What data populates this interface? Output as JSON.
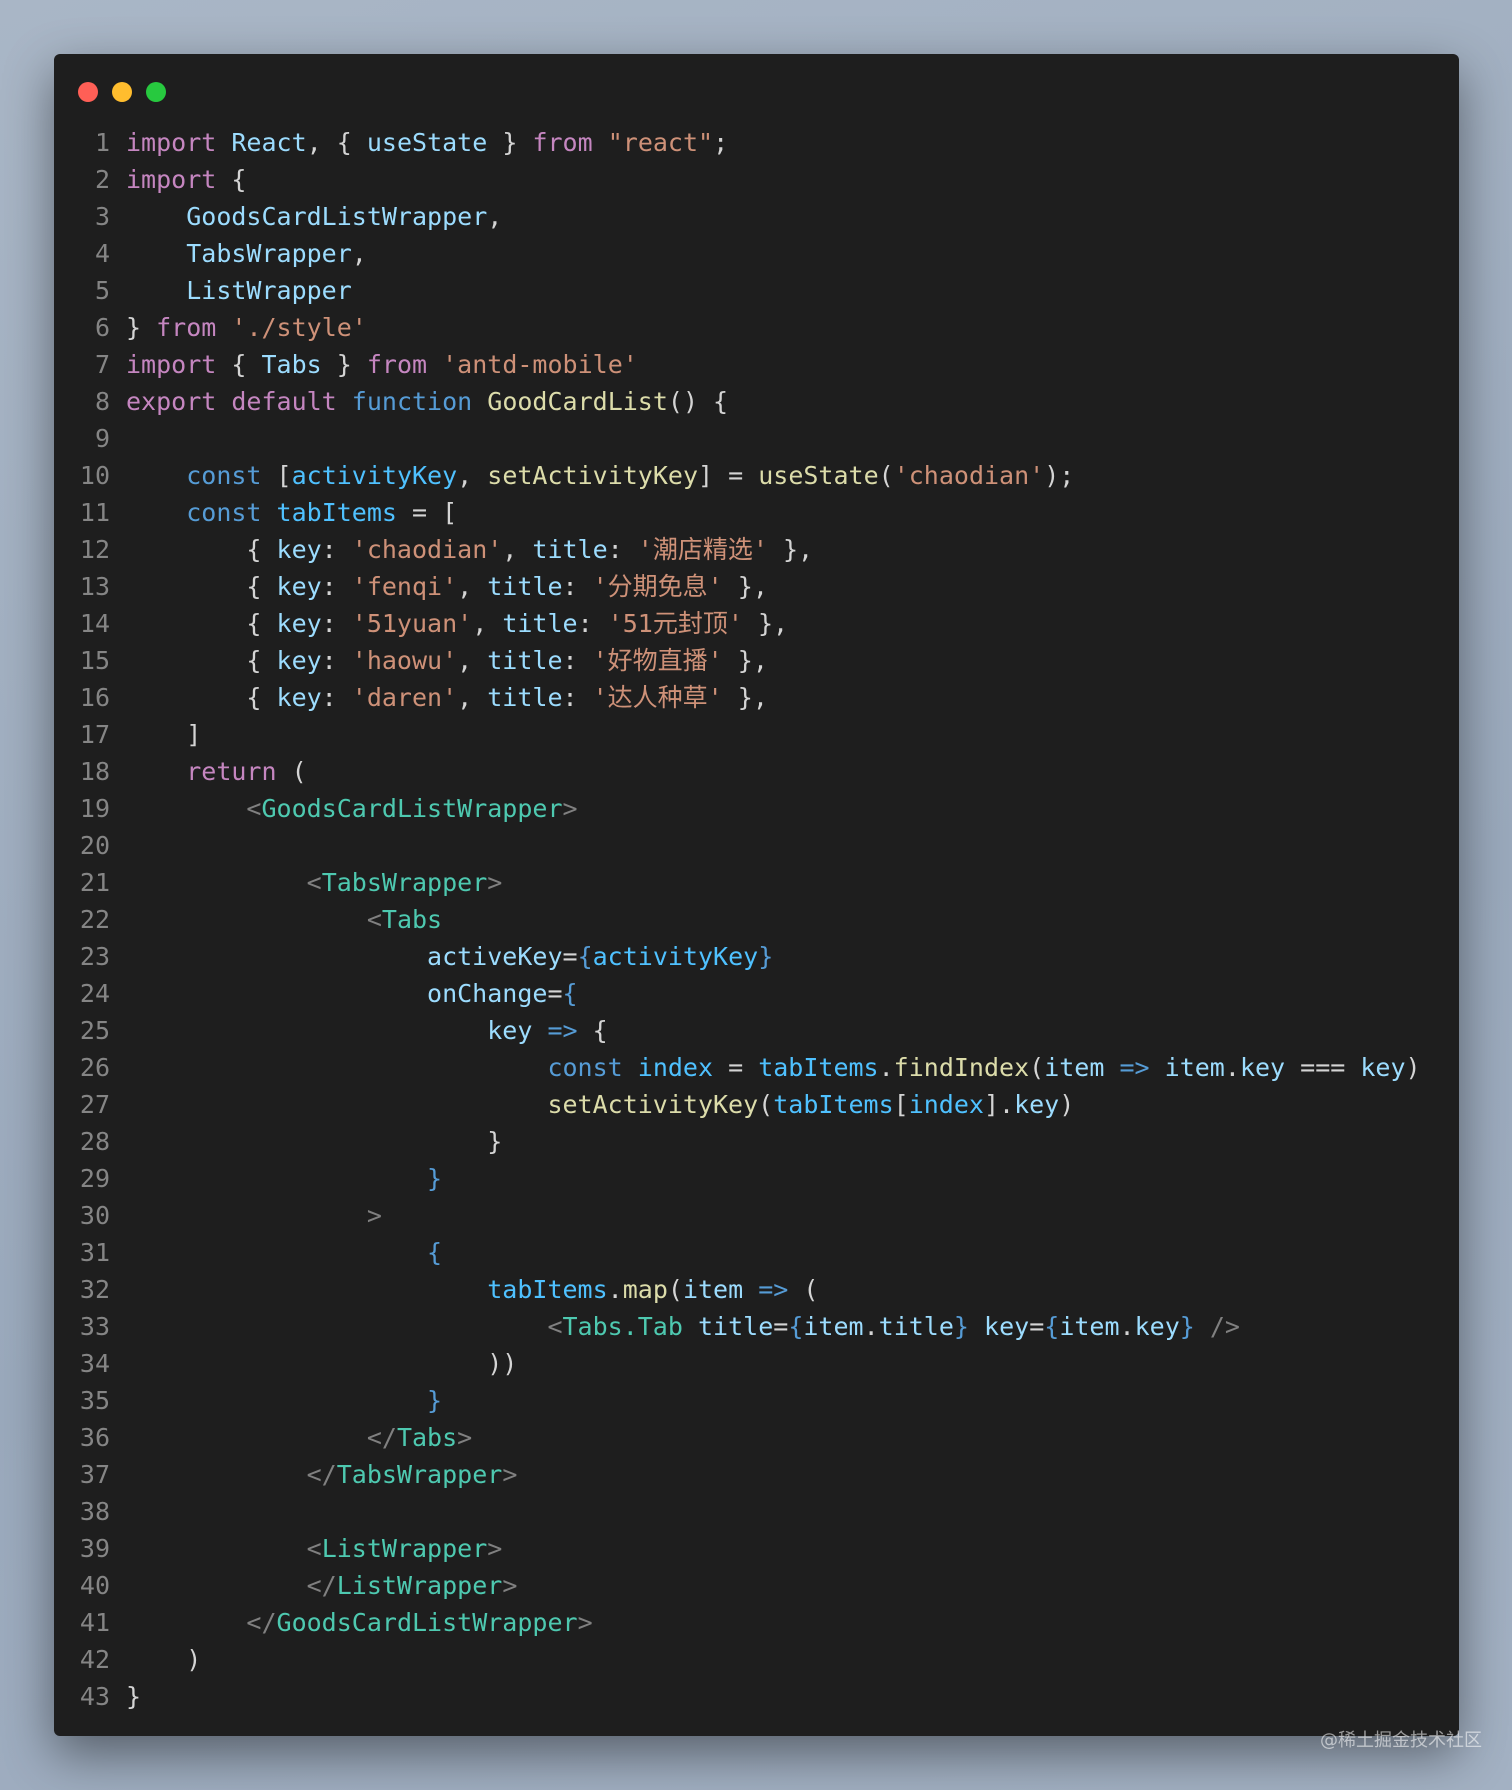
{
  "window_controls": [
    {
      "name": "close-button",
      "color": "#ff5f56"
    },
    {
      "name": "minimize-button",
      "color": "#ffbd2e"
    },
    {
      "name": "maximize-button",
      "color": "#27c93f"
    }
  ],
  "colors": {
    "keyword": "#c586c0",
    "storage": "#569cd6",
    "variable": "#9cdcfe",
    "func": "#dcdcaa",
    "string": "#ce9178",
    "tag": "#4ec9b0",
    "const": "#4fc1ff",
    "plain": "#d4d4d4",
    "punct": "#808080"
  },
  "lines": [
    [
      [
        "import",
        "keyword"
      ],
      [
        " "
      ],
      [
        "React",
        "variable"
      ],
      [
        ", { "
      ],
      [
        "useState",
        "variable"
      ],
      [
        " } "
      ],
      [
        "from",
        "keyword"
      ],
      [
        " "
      ],
      [
        "\"react\"",
        "string"
      ],
      [
        ";"
      ]
    ],
    [
      [
        "import",
        "keyword"
      ],
      [
        " {"
      ]
    ],
    [
      [
        "    "
      ],
      [
        "GoodsCardListWrapper",
        "variable"
      ],
      [
        ","
      ]
    ],
    [
      [
        "    "
      ],
      [
        "TabsWrapper",
        "variable"
      ],
      [
        ","
      ]
    ],
    [
      [
        "    "
      ],
      [
        "ListWrapper",
        "variable"
      ]
    ],
    [
      [
        "} "
      ],
      [
        "from",
        "keyword"
      ],
      [
        " "
      ],
      [
        "'./style'",
        "string"
      ]
    ],
    [
      [
        "import",
        "keyword"
      ],
      [
        " { "
      ],
      [
        "Tabs",
        "variable"
      ],
      [
        " } "
      ],
      [
        "from",
        "keyword"
      ],
      [
        " "
      ],
      [
        "'antd-mobile'",
        "string"
      ]
    ],
    [
      [
        "export",
        "keyword"
      ],
      [
        " "
      ],
      [
        "default",
        "keyword"
      ],
      [
        " "
      ],
      [
        "function",
        "storage"
      ],
      [
        " "
      ],
      [
        "GoodCardList",
        "func"
      ],
      [
        "() {"
      ]
    ],
    [],
    [
      [
        "    "
      ],
      [
        "const",
        "storage"
      ],
      [
        " ["
      ],
      [
        "activityKey",
        "const"
      ],
      [
        ", "
      ],
      [
        "setActivityKey",
        "func"
      ],
      [
        "] = "
      ],
      [
        "useState",
        "func"
      ],
      [
        "("
      ],
      [
        "'chaodian'",
        "string"
      ],
      [
        ");"
      ]
    ],
    [
      [
        "    "
      ],
      [
        "const",
        "storage"
      ],
      [
        " "
      ],
      [
        "tabItems",
        "const"
      ],
      [
        " = ["
      ]
    ],
    [
      [
        "        { "
      ],
      [
        "key",
        "variable"
      ],
      [
        ": "
      ],
      [
        "'chaodian'",
        "string"
      ],
      [
        ", "
      ],
      [
        "title",
        "variable"
      ],
      [
        ": "
      ],
      [
        "'潮店精选'",
        "string"
      ],
      [
        " },"
      ]
    ],
    [
      [
        "        { "
      ],
      [
        "key",
        "variable"
      ],
      [
        ": "
      ],
      [
        "'fenqi'",
        "string"
      ],
      [
        ", "
      ],
      [
        "title",
        "variable"
      ],
      [
        ": "
      ],
      [
        "'分期免息'",
        "string"
      ],
      [
        " },"
      ]
    ],
    [
      [
        "        { "
      ],
      [
        "key",
        "variable"
      ],
      [
        ": "
      ],
      [
        "'51yuan'",
        "string"
      ],
      [
        ", "
      ],
      [
        "title",
        "variable"
      ],
      [
        ": "
      ],
      [
        "'51元封顶'",
        "string"
      ],
      [
        " },"
      ]
    ],
    [
      [
        "        { "
      ],
      [
        "key",
        "variable"
      ],
      [
        ": "
      ],
      [
        "'haowu'",
        "string"
      ],
      [
        ", "
      ],
      [
        "title",
        "variable"
      ],
      [
        ": "
      ],
      [
        "'好物直播'",
        "string"
      ],
      [
        " },"
      ]
    ],
    [
      [
        "        { "
      ],
      [
        "key",
        "variable"
      ],
      [
        ": "
      ],
      [
        "'daren'",
        "string"
      ],
      [
        ", "
      ],
      [
        "title",
        "variable"
      ],
      [
        ": "
      ],
      [
        "'达人种草'",
        "string"
      ],
      [
        " },"
      ]
    ],
    [
      [
        "    ]"
      ]
    ],
    [
      [
        "    "
      ],
      [
        "return",
        "keyword"
      ],
      [
        " ("
      ]
    ],
    [
      [
        "        "
      ],
      [
        "<",
        "punct"
      ],
      [
        "GoodsCardListWrapper",
        "tag"
      ],
      [
        ">",
        "punct"
      ]
    ],
    [],
    [
      [
        "            "
      ],
      [
        "<",
        "punct"
      ],
      [
        "TabsWrapper",
        "tag"
      ],
      [
        ">",
        "punct"
      ]
    ],
    [
      [
        "                "
      ],
      [
        "<",
        "punct"
      ],
      [
        "Tabs",
        "tag"
      ]
    ],
    [
      [
        "                    "
      ],
      [
        "activeKey",
        "variable"
      ],
      [
        "="
      ],
      [
        "{",
        "storage"
      ],
      [
        "activityKey",
        "const"
      ],
      [
        "}",
        "storage"
      ]
    ],
    [
      [
        "                    "
      ],
      [
        "onChange",
        "variable"
      ],
      [
        "="
      ],
      [
        "{",
        "storage"
      ]
    ],
    [
      [
        "                        "
      ],
      [
        "key",
        "variable"
      ],
      [
        " "
      ],
      [
        "=>",
        "storage"
      ],
      [
        " {"
      ]
    ],
    [
      [
        "                            "
      ],
      [
        "const",
        "storage"
      ],
      [
        " "
      ],
      [
        "index",
        "const"
      ],
      [
        " = "
      ],
      [
        "tabItems",
        "const"
      ],
      [
        "."
      ],
      [
        "findIndex",
        "func"
      ],
      [
        "("
      ],
      [
        "item",
        "variable"
      ],
      [
        " "
      ],
      [
        "=>",
        "storage"
      ],
      [
        " "
      ],
      [
        "item",
        "variable"
      ],
      [
        "."
      ],
      [
        "key",
        "variable"
      ],
      [
        " === "
      ],
      [
        "key",
        "variable"
      ],
      [
        ")"
      ]
    ],
    [
      [
        "                            "
      ],
      [
        "setActivityKey",
        "func"
      ],
      [
        "("
      ],
      [
        "tabItems",
        "const"
      ],
      [
        "["
      ],
      [
        "index",
        "const"
      ],
      [
        "]."
      ],
      [
        "key",
        "variable"
      ],
      [
        ")"
      ]
    ],
    [
      [
        "                        }"
      ]
    ],
    [
      [
        "                    "
      ],
      [
        "}",
        "storage"
      ]
    ],
    [
      [
        "                "
      ],
      [
        ">",
        "punct"
      ]
    ],
    [
      [
        "                    "
      ],
      [
        "{",
        "storage"
      ]
    ],
    [
      [
        "                        "
      ],
      [
        "tabItems",
        "const"
      ],
      [
        "."
      ],
      [
        "map",
        "func"
      ],
      [
        "("
      ],
      [
        "item",
        "variable"
      ],
      [
        " "
      ],
      [
        "=>",
        "storage"
      ],
      [
        " ("
      ]
    ],
    [
      [
        "                            "
      ],
      [
        "<",
        "punct"
      ],
      [
        "Tabs.Tab",
        "tag"
      ],
      [
        " "
      ],
      [
        "title",
        "variable"
      ],
      [
        "="
      ],
      [
        "{",
        "storage"
      ],
      [
        "item",
        "variable"
      ],
      [
        "."
      ],
      [
        "title",
        "variable"
      ],
      [
        "}",
        "storage"
      ],
      [
        " "
      ],
      [
        "key",
        "variable"
      ],
      [
        "="
      ],
      [
        "{",
        "storage"
      ],
      [
        "item",
        "variable"
      ],
      [
        "."
      ],
      [
        "key",
        "variable"
      ],
      [
        "}",
        "storage"
      ],
      [
        " />",
        "punct"
      ]
    ],
    [
      [
        "                        ))"
      ]
    ],
    [
      [
        "                    "
      ],
      [
        "}",
        "storage"
      ]
    ],
    [
      [
        "                "
      ],
      [
        "</",
        "punct"
      ],
      [
        "Tabs",
        "tag"
      ],
      [
        ">",
        "punct"
      ]
    ],
    [
      [
        "            "
      ],
      [
        "</",
        "punct"
      ],
      [
        "TabsWrapper",
        "tag"
      ],
      [
        ">",
        "punct"
      ]
    ],
    [],
    [
      [
        "            "
      ],
      [
        "<",
        "punct"
      ],
      [
        "ListWrapper",
        "tag"
      ],
      [
        ">",
        "punct"
      ]
    ],
    [
      [
        "            "
      ],
      [
        "</",
        "punct"
      ],
      [
        "ListWrapper",
        "tag"
      ],
      [
        ">",
        "punct"
      ]
    ],
    [
      [
        "        "
      ],
      [
        "</",
        "punct"
      ],
      [
        "GoodsCardListWrapper",
        "tag"
      ],
      [
        ">",
        "punct"
      ]
    ],
    [
      [
        "    )"
      ]
    ],
    [
      [
        "}"
      ]
    ]
  ],
  "watermark": "@稀土掘金技术社区"
}
